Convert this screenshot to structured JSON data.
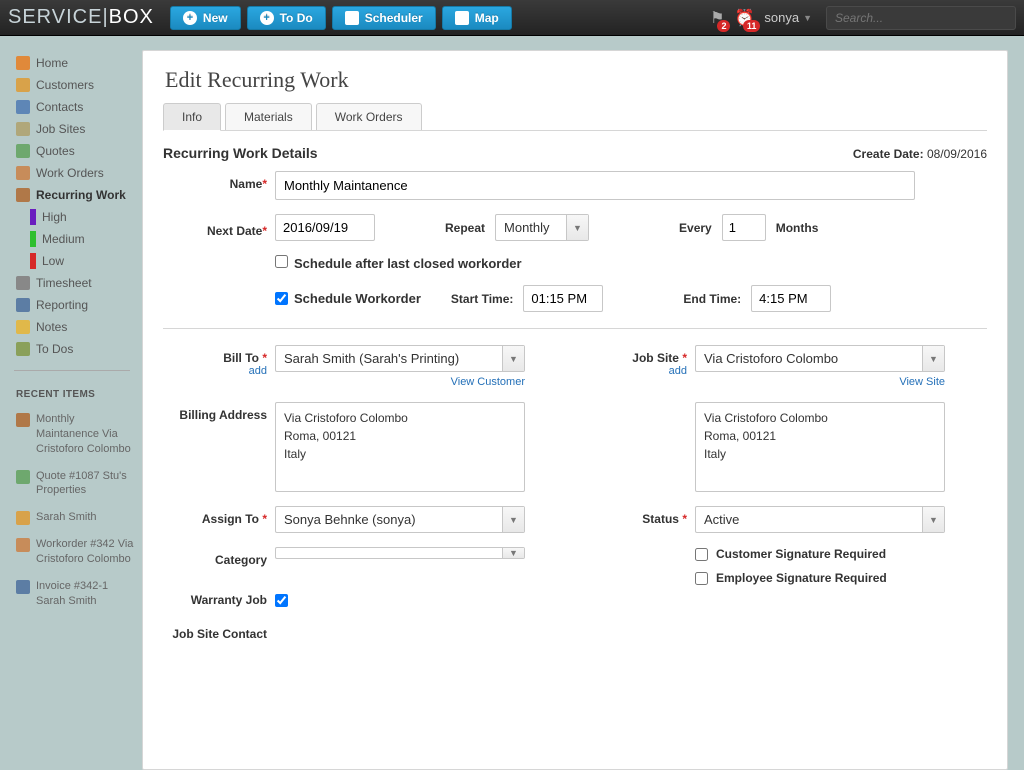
{
  "topbar": {
    "logo_left": "SERVICE",
    "logo_right": "BOX",
    "buttons": {
      "new": "New",
      "todo": "To Do",
      "scheduler": "Scheduler",
      "map": "Map"
    },
    "notif1_count": "2",
    "notif2_count": "11",
    "username": "sonya",
    "search_placeholder": "Search..."
  },
  "sidebar": {
    "items": [
      {
        "label": "Home"
      },
      {
        "label": "Customers"
      },
      {
        "label": "Contacts"
      },
      {
        "label": "Job Sites"
      },
      {
        "label": "Quotes"
      },
      {
        "label": "Work Orders"
      },
      {
        "label": "Recurring Work"
      },
      {
        "label": "Timesheet"
      },
      {
        "label": "Reporting"
      },
      {
        "label": "Notes"
      },
      {
        "label": "To Dos"
      }
    ],
    "priorities": [
      {
        "label": "High",
        "color": "#6a1dbf"
      },
      {
        "label": "Medium",
        "color": "#2fbf2f"
      },
      {
        "label": "Low",
        "color": "#d62828"
      }
    ],
    "recent_header": "RECENT ITEMS",
    "recent": [
      {
        "label": "Monthly Maintanence Via Cristoforo Colombo"
      },
      {
        "label": "Quote #1087 Stu's Properties"
      },
      {
        "label": "Sarah Smith"
      },
      {
        "label": "Workorder #342 Via Cristoforo Colombo"
      },
      {
        "label": "Invoice #342-1 Sarah Smith"
      }
    ]
  },
  "main": {
    "title": "Edit Recurring Work",
    "tabs": [
      {
        "label": "Info"
      },
      {
        "label": "Materials"
      },
      {
        "label": "Work Orders"
      }
    ],
    "section_title": "Recurring Work Details",
    "create_date_label": "Create Date:",
    "create_date_value": "08/09/2016",
    "labels": {
      "name": "Name",
      "next_date": "Next Date",
      "repeat": "Repeat",
      "every": "Every",
      "months": "Months",
      "schedule_after": "Schedule after last closed workorder",
      "schedule_wo": "Schedule Workorder",
      "start_time": "Start Time:",
      "end_time": "End Time:",
      "bill_to": "Bill To",
      "job_site": "Job Site",
      "billing_addr": "Billing Address",
      "assign_to": "Assign To",
      "status": "Status",
      "category": "Category",
      "cust_sig": "Customer Signature Required",
      "emp_sig": "Employee Signature Required",
      "warranty": "Warranty Job",
      "jobsite_contact": "Job Site Contact",
      "add": "add",
      "view_customer": "View Customer",
      "view_site": "View Site"
    },
    "values": {
      "name": "Monthly Maintanence",
      "next_date": "2016/09/19",
      "repeat": "Monthly",
      "every": "1",
      "start_time": "01:15 PM",
      "end_time": "4:15 PM",
      "bill_to": "Sarah Smith (Sarah's Printing)",
      "job_site": "Via Cristoforo Colombo",
      "billing_address": "Via Cristoforo Colombo\nRoma, 00121\nItaly",
      "site_address": "Via Cristoforo Colombo\nRoma, 00121\nItaly",
      "assign_to": "Sonya Behnke (sonya)",
      "status": "Active",
      "category": ""
    }
  }
}
